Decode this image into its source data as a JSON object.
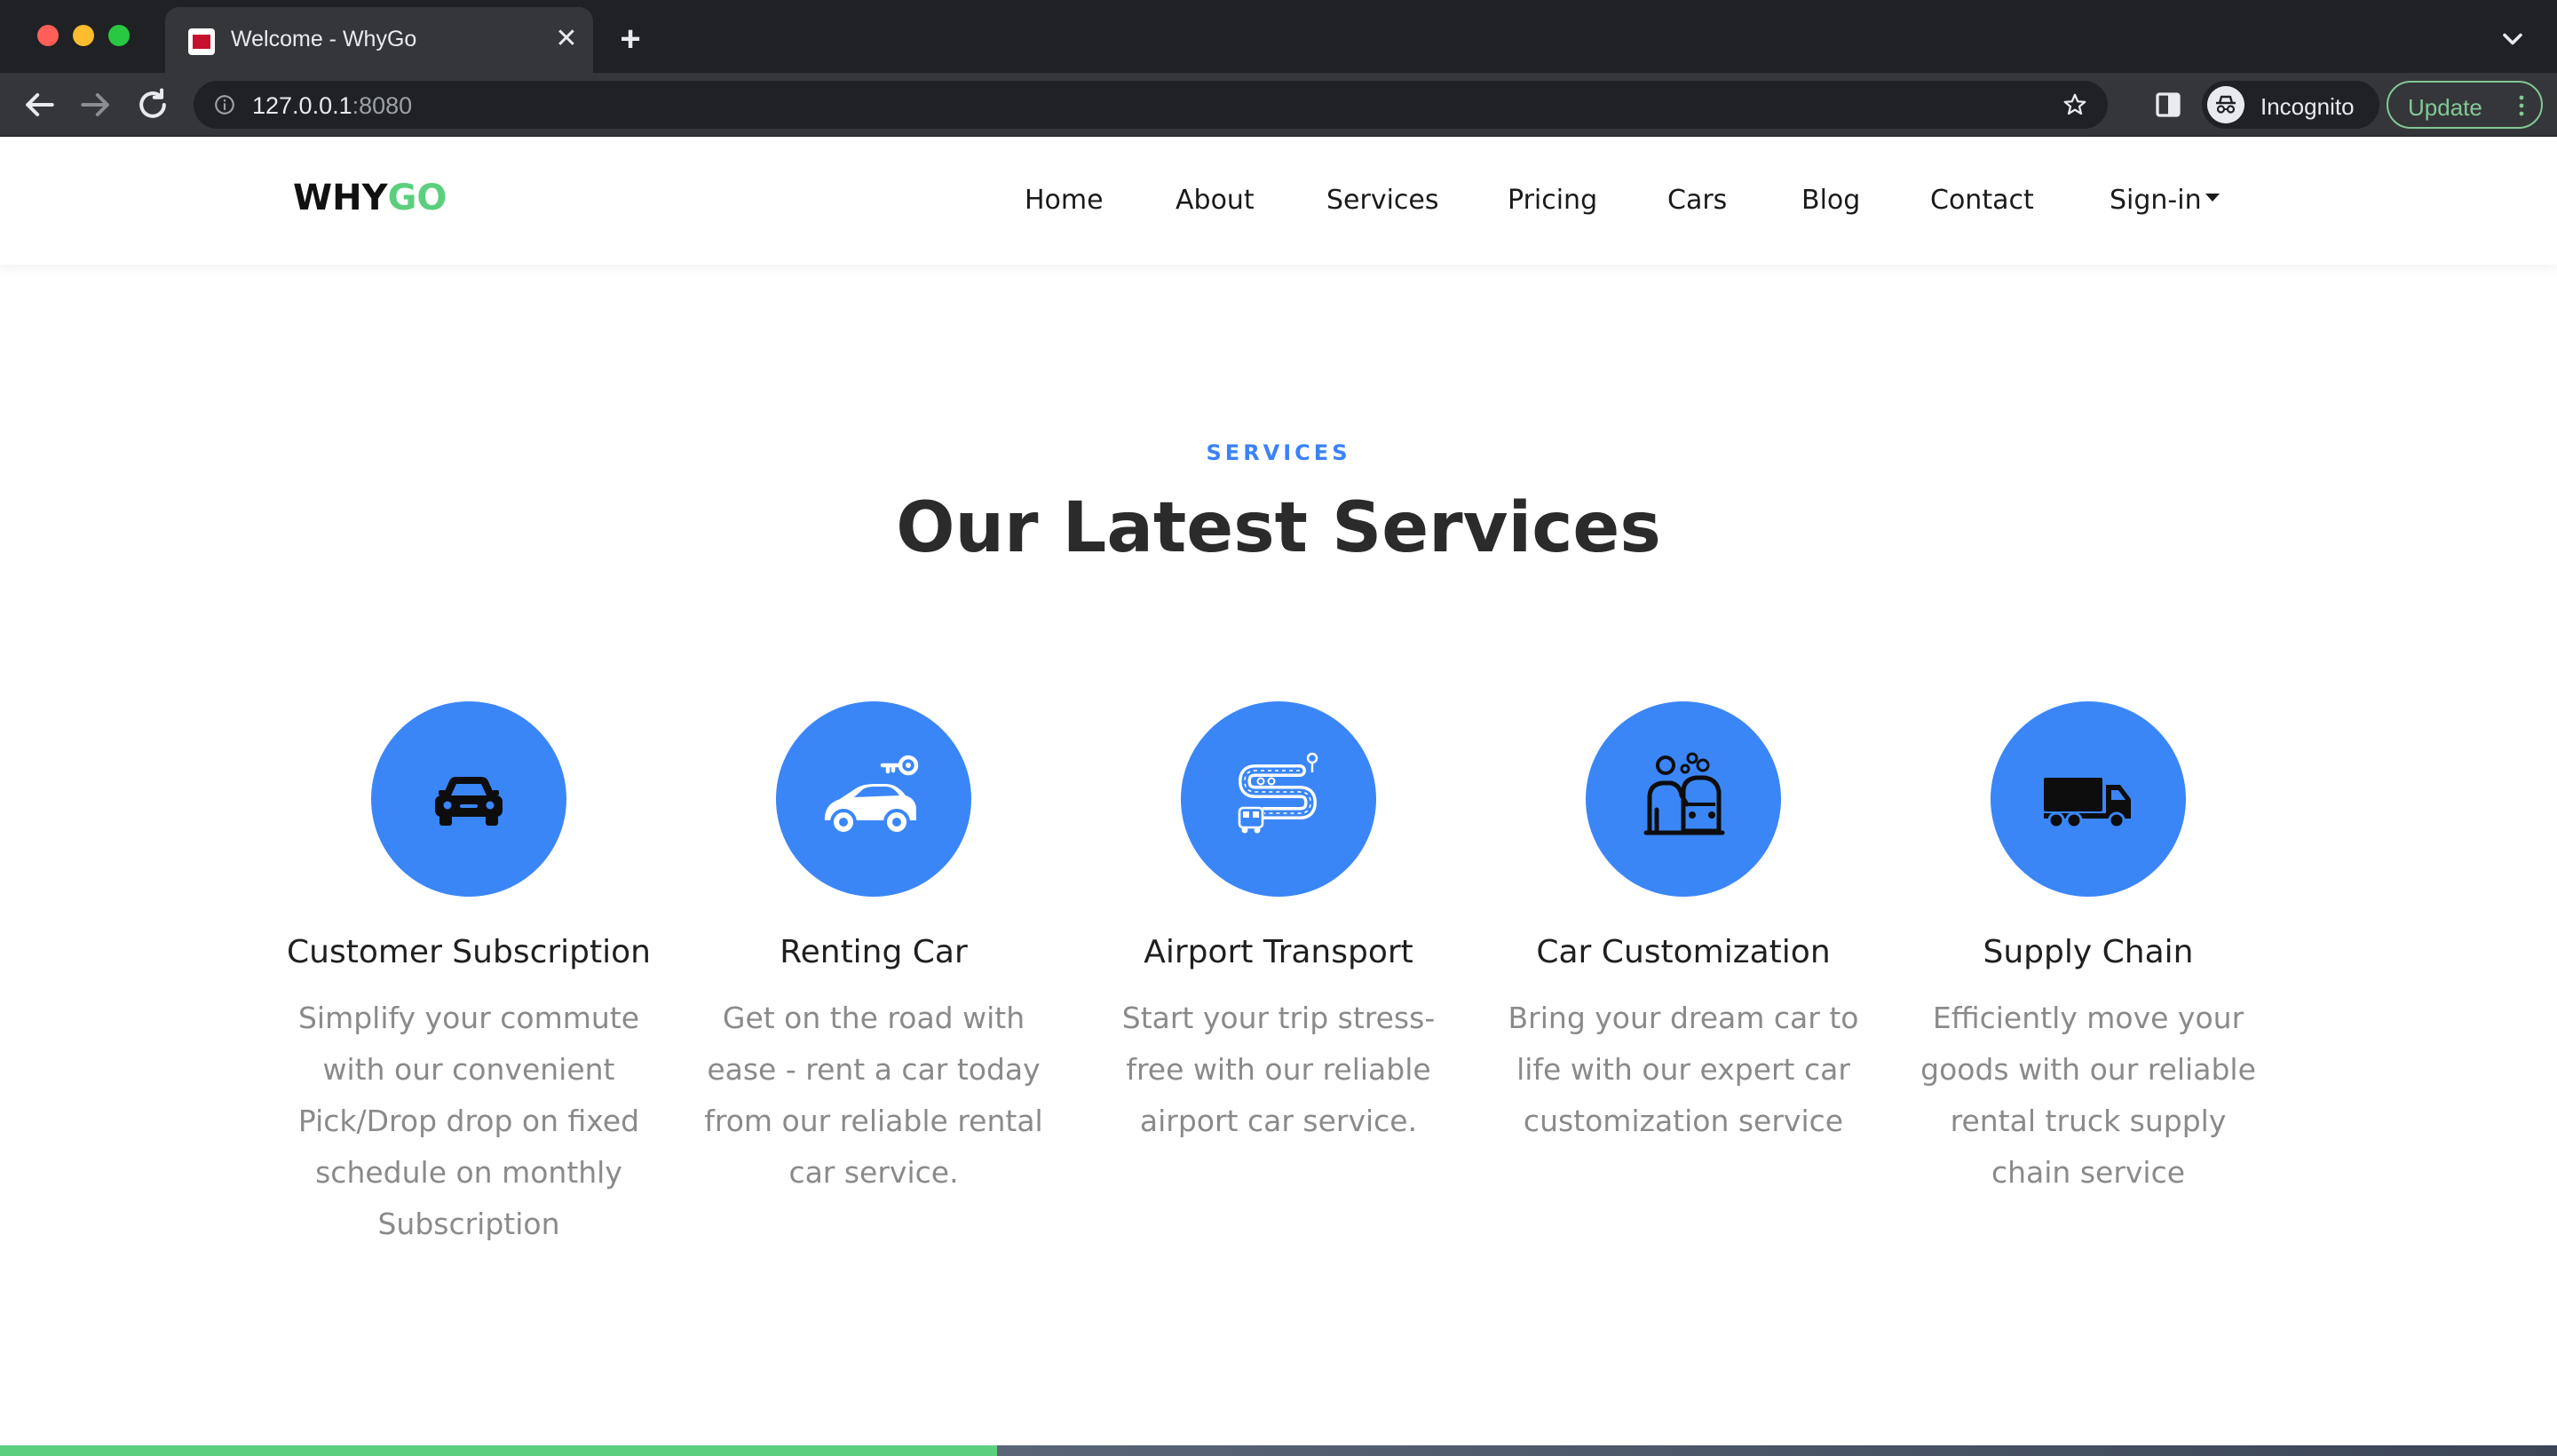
{
  "browser": {
    "tab_title": "Welcome - WhyGo",
    "url_host": "127.0.0.1",
    "url_port": ":8080",
    "profile_label": "Incognito",
    "update_label": "Update"
  },
  "site": {
    "logo_why": "WHY",
    "logo_go": "GO",
    "nav": {
      "home": "Home",
      "about": "About",
      "services": "Services",
      "pricing": "Pricing",
      "cars": "Cars",
      "blog": "Blog",
      "contact": "Contact",
      "signin": "Sign-in"
    }
  },
  "services": {
    "eyebrow": "SERVICES",
    "title": "Our Latest Services",
    "items": [
      {
        "icon": "car-front-icon",
        "title": "Customer Subscription",
        "desc": "Simplify your commute with our convenient Pick/Drop drop on fixed schedule on monthly Subscription"
      },
      {
        "icon": "car-key-icon",
        "title": "Renting Car",
        "desc": "Get on the road with ease - rent a car today from our reliable rental car service."
      },
      {
        "icon": "route-bus-icon",
        "title": "Airport Transport",
        "desc": "Start your trip stress-free with our reliable airport car service."
      },
      {
        "icon": "car-wash-icon",
        "title": "Car Customization",
        "desc": "Bring your dream car to life with our expert car customization service"
      },
      {
        "icon": "truck-icon",
        "title": "Supply Chain",
        "desc": "Efficiently move your goods with our reliable rental truck supply chain service"
      }
    ]
  },
  "colors": {
    "accent_blue": "#3b86f7",
    "brand_green": "#5ccf7f",
    "heading": "#2b2b2b",
    "body_text": "#8a8a8a"
  }
}
